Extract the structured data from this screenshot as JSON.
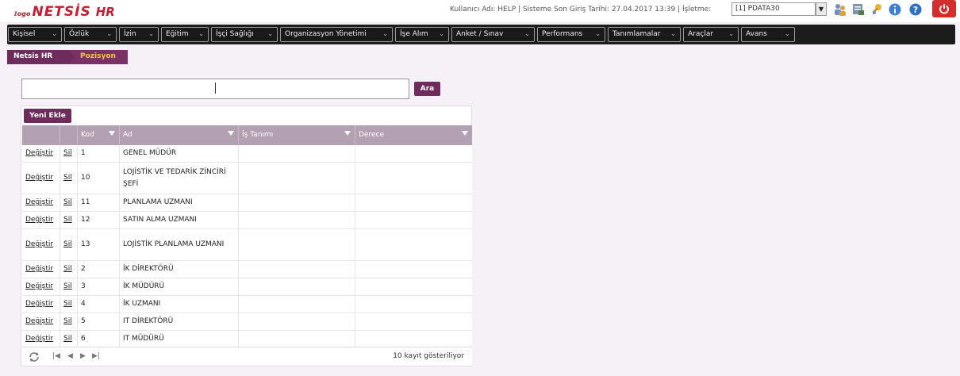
{
  "header": {
    "logo_small": "ℓogo",
    "logo_name": "NETSİS",
    "logo_suffix": "HR",
    "user_info": "Kullanıcı Adı: HELP | Sisteme Son Giriş Tarihi: 27.04.2017 13:39 | İşletme:",
    "company_value": "[1] PDATA30",
    "icons": [
      "users-icon",
      "report-icon",
      "key-icon",
      "info-icon",
      "help-icon",
      "power-icon"
    ]
  },
  "menu": {
    "items": [
      {
        "label": "Kişisel"
      },
      {
        "label": "Özlük"
      },
      {
        "label": "İzin"
      },
      {
        "label": "Eğitim"
      },
      {
        "label": "İşçi Sağlığı"
      },
      {
        "label": "Organizasyon Yönetimi"
      },
      {
        "label": "İşe Alım"
      },
      {
        "label": "Anket / Sınav"
      },
      {
        "label": "Performans"
      },
      {
        "label": "Tanımlamalar"
      },
      {
        "label": "Araçlar"
      },
      {
        "label": "Avans"
      }
    ]
  },
  "breadcrumb": {
    "root": "Netsis HR",
    "current": "Pozisyon"
  },
  "search": {
    "value": "",
    "button_label": "Ara"
  },
  "grid": {
    "new_button": "Yeni Ekle",
    "columns": {
      "kod": "Kod",
      "ad": "Ad",
      "is_tanimi": "İş Tanımı",
      "derece": "Derece"
    },
    "edit_label": "Değiştir",
    "delete_label": "Sil",
    "rows": [
      {
        "kod": "1",
        "ad": "GENEL MÜDÜR",
        "is_tanimi": "",
        "derece": ""
      },
      {
        "kod": "10",
        "ad": "LOJİSTİK VE TEDARİK ZİNCİRİ ŞEFİ",
        "is_tanimi": "",
        "derece": ""
      },
      {
        "kod": "11",
        "ad": "PLANLAMA UZMANI",
        "is_tanimi": "",
        "derece": ""
      },
      {
        "kod": "12",
        "ad": "SATIN ALMA UZMANI",
        "is_tanimi": "",
        "derece": ""
      },
      {
        "kod": "13",
        "ad": "LOJİSTİK PLANLAMA UZMANI",
        "is_tanimi": "",
        "derece": ""
      },
      {
        "kod": "2",
        "ad": "İK DİREKTÖRÜ",
        "is_tanimi": "",
        "derece": ""
      },
      {
        "kod": "3",
        "ad": "İK MÜDÜRÜ",
        "is_tanimi": "",
        "derece": ""
      },
      {
        "kod": "4",
        "ad": "İK UZMANI",
        "is_tanimi": "",
        "derece": ""
      },
      {
        "kod": "5",
        "ad": "IT DİREKTÖRÜ",
        "is_tanimi": "",
        "derece": ""
      },
      {
        "kod": "6",
        "ad": "IT MÜDÜRÜ",
        "is_tanimi": "",
        "derece": ""
      }
    ],
    "footer_text": "10 kayıt gösteriliyor"
  },
  "colors": {
    "accent": "#6e2c5c",
    "header_grid": "#b3a0b3",
    "breadcrumb_current": "#f5c73d",
    "logo": "#c61f35"
  }
}
